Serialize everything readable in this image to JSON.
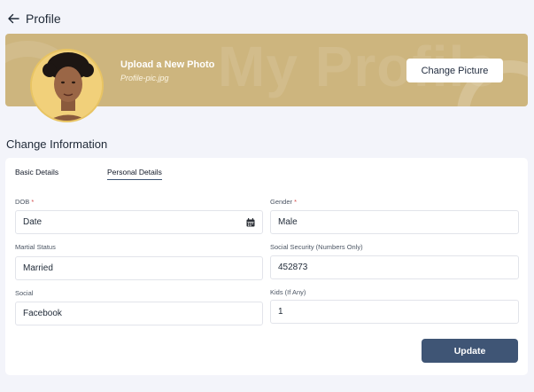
{
  "header": {
    "title": "Profile",
    "back_icon": "arrow-left-icon"
  },
  "banner": {
    "watermark": "My Profile",
    "upload_title": "Upload a New Photo",
    "file_name": "Profile-pic.jpg",
    "change_button": "Change Picture",
    "background_color": "#cdb57e"
  },
  "section": {
    "title": "Change Information"
  },
  "tabs": [
    {
      "label": "Basic Details",
      "active": false
    },
    {
      "label": "Personal Details",
      "active": true
    }
  ],
  "form": {
    "dob": {
      "label": "DOB",
      "required_mark": "*",
      "value": "Date",
      "icon": "calendar-icon"
    },
    "gender": {
      "label": "Gender",
      "required_mark": "*",
      "value": "Male"
    },
    "marital_status": {
      "label": "Martial Status",
      "value": "Married"
    },
    "social_security": {
      "label": "Social Security (Numbers Only)",
      "value": "452873"
    },
    "social": {
      "label": "Social",
      "value": "Facebook"
    },
    "kids": {
      "label": "Kids (If Any)",
      "value": "1"
    }
  },
  "actions": {
    "update": "Update",
    "accent_color": "#3f5575"
  }
}
